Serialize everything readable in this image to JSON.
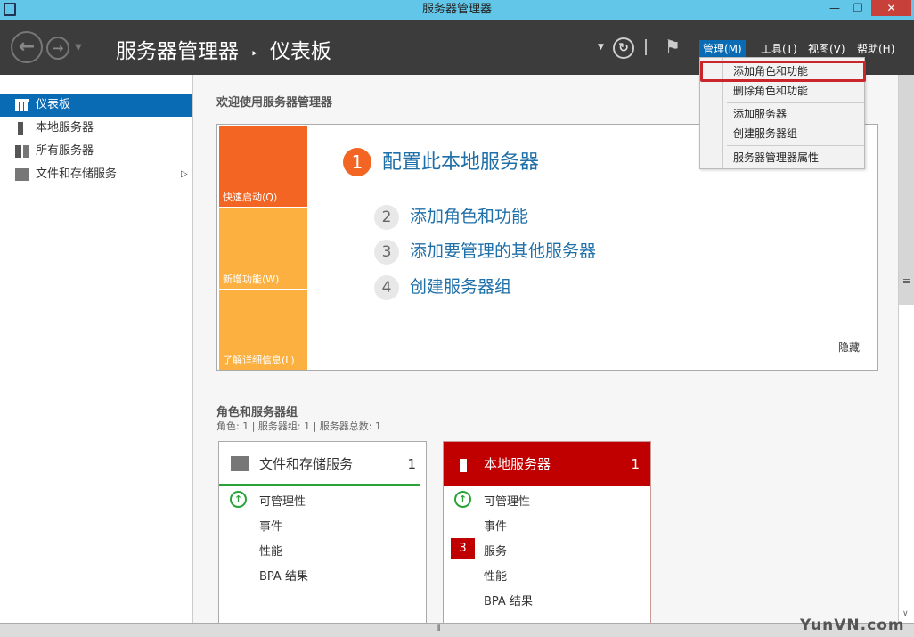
{
  "window": {
    "title": "服务器管理器",
    "min": "—",
    "restore": "❐",
    "close": "✕"
  },
  "header": {
    "breadcrumb_root": "服务器管理器",
    "breadcrumb_sep": "‣",
    "breadcrumb_page": "仪表板",
    "menus": [
      "管理(M)",
      "工具(T)",
      "视图(V)",
      "帮助(H)"
    ]
  },
  "manage_menu": {
    "items": [
      "添加角色和功能",
      "删除角色和功能",
      "添加服务器",
      "创建服务器组",
      "服务器管理器属性"
    ],
    "highlighted": "添加角色和功能"
  },
  "sidebar": {
    "items": [
      {
        "label": "仪表板",
        "active": true
      },
      {
        "label": "本地服务器"
      },
      {
        "label": "所有服务器"
      },
      {
        "label": "文件和存储服务",
        "has_arrow": true
      }
    ]
  },
  "welcome": {
    "heading": "欢迎使用服务器管理器",
    "tiles": [
      "快速启动(Q)",
      "新增功能(W)",
      "了解详细信息(L)"
    ],
    "steps": [
      {
        "num": "1",
        "label": "配置此本地服务器"
      },
      {
        "num": "2",
        "label": "添加角色和功能"
      },
      {
        "num": "3",
        "label": "添加要管理的其他服务器"
      },
      {
        "num": "4",
        "label": "创建服务器组"
      }
    ],
    "hide": "隐藏"
  },
  "roles": {
    "heading": "角色和服务器组",
    "summary": "角色: 1 | 服务器组: 1 | 服务器总数: 1",
    "cards": [
      {
        "title": "文件和存储服务",
        "count": "1",
        "rows": [
          "可管理性",
          "事件",
          "性能",
          "BPA 结果"
        ]
      },
      {
        "title": "本地服务器",
        "count": "1",
        "rows": [
          "可管理性",
          "事件",
          "服务",
          "性能",
          "BPA 结果"
        ],
        "services_badge": "3"
      }
    ]
  },
  "colors": {
    "accent": "#0a6bb5",
    "orange": "#f26522",
    "light_orange": "#fbb040",
    "alert": "#c00000",
    "ok": "#2aa43a"
  },
  "watermark": "YunVN.com"
}
